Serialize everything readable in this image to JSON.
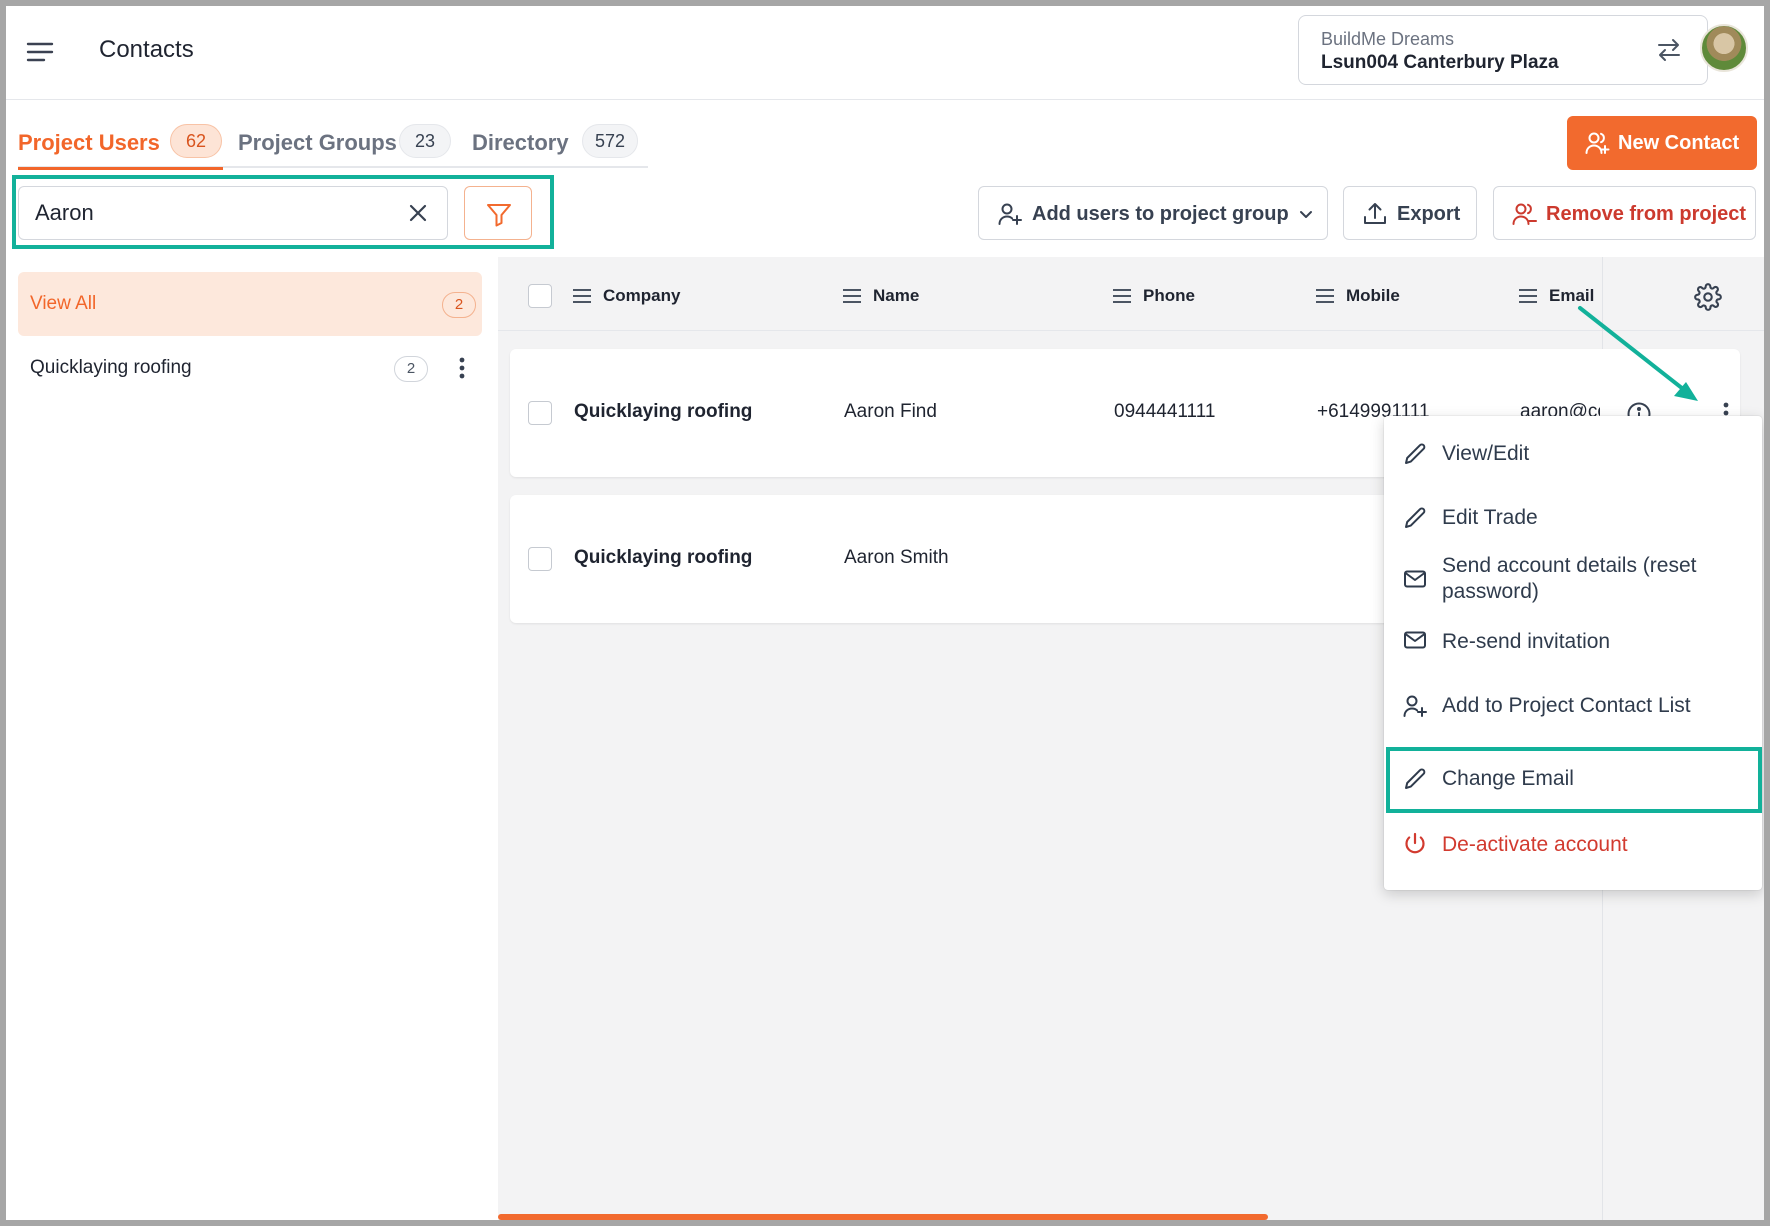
{
  "header": {
    "title": "Contacts",
    "project_switcher": {
      "company": "BuildMe Dreams",
      "project": "Lsun004 Canterbury Plaza"
    }
  },
  "tabs": [
    {
      "label": "Project Users",
      "count": "62",
      "active": true
    },
    {
      "label": "Project Groups",
      "count": "23",
      "active": false
    },
    {
      "label": "Directory",
      "count": "572",
      "active": false
    }
  ],
  "toolbar": {
    "new_contact": "New Contact",
    "search_value": "Aaron",
    "add_to_group": "Add users to project group",
    "export": "Export",
    "remove_from_project": "Remove from project"
  },
  "sidebar": {
    "items": [
      {
        "label": "View All",
        "count": "2",
        "active": true
      },
      {
        "label": "Quicklaying roofing",
        "count": "2",
        "active": false
      }
    ]
  },
  "table": {
    "columns": [
      "Company",
      "Name",
      "Phone",
      "Mobile",
      "Email"
    ],
    "rows": [
      {
        "company": "Quicklaying roofing",
        "name": "Aaron Find",
        "phone": "0944441111",
        "mobile": "+6149991111",
        "email": "aaron@co"
      },
      {
        "company": "Quicklaying roofing",
        "name": "Aaron Smith",
        "phone": "",
        "mobile": "",
        "email": ""
      }
    ]
  },
  "row_menu": {
    "items": [
      {
        "label": "View/Edit",
        "icon": "pencil-icon"
      },
      {
        "label": "Edit Trade",
        "icon": "pencil-icon"
      },
      {
        "label": "Send account details (reset password)",
        "icon": "mail-icon"
      },
      {
        "label": "Re-send invitation",
        "icon": "mail-icon"
      },
      {
        "label": "Add to Project Contact List",
        "icon": "user-plus-icon"
      },
      {
        "label": "Change Email",
        "icon": "pencil-icon",
        "highlighted": true
      },
      {
        "label": "De-activate account",
        "icon": "power-icon",
        "danger": true
      }
    ]
  },
  "colors": {
    "accent": "#f26a2e",
    "annotation": "#12b19a",
    "danger": "#d23a2f"
  }
}
